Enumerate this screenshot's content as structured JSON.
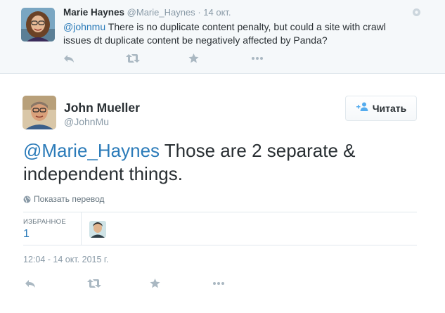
{
  "parent_tweet": {
    "name": "Marie Haynes",
    "handle": "@Marie_Haynes",
    "separator": "·",
    "date": "14 окт.",
    "mention": "@johnmu",
    "text": " There is no duplicate content penalty, but could a site with crawl issues dt duplicate content be negatively affected by Panda?"
  },
  "main_tweet": {
    "name": "John Mueller",
    "handle": "@JohnMu",
    "follow_label": "Читать",
    "mention": "@Marie_Haynes",
    "text": " Those are 2 separate & independent things.",
    "translate_label": "Показать перевод",
    "favorites_label": "ИЗБРАННОЕ",
    "favorites_count": "1",
    "timestamp": "12:04 - 14 окт. 2015 г."
  },
  "icons": {
    "reply": "reply-icon",
    "retweet": "retweet-icon",
    "favorite": "star-icon",
    "more": "more-dots-icon",
    "follow": "add-user-icon",
    "translate": "globe-icon"
  },
  "colors": {
    "link": "#2b7bb9",
    "action_icon": "#aab8c2",
    "secondary_text": "#8899a6",
    "context_background": "#f5f8fa"
  }
}
